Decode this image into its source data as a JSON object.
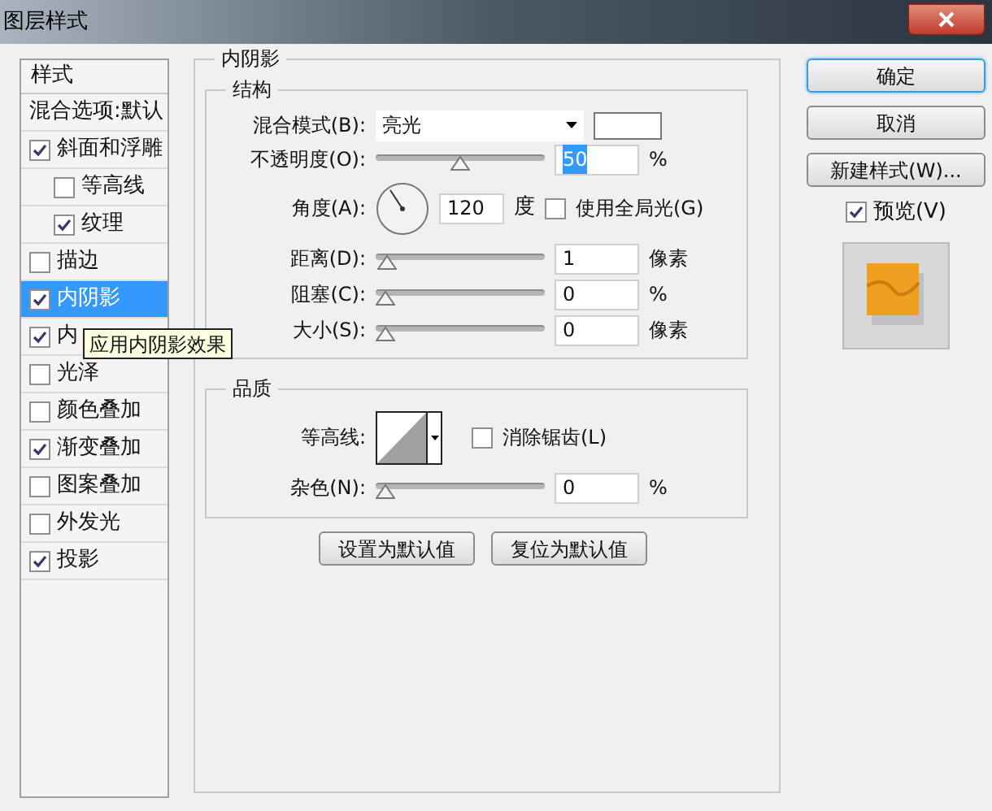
{
  "window": {
    "title": "图层样式"
  },
  "sidebar": {
    "header": "样式",
    "items": [
      {
        "kind": "plain",
        "label": "混合选项:默认",
        "selected": false
      },
      {
        "kind": "check",
        "label": "斜面和浮雕",
        "checked": true,
        "selected": false,
        "children": [
          {
            "kind": "check",
            "label": "等高线",
            "checked": false,
            "selected": false
          },
          {
            "kind": "check",
            "label": "纹理",
            "checked": true,
            "selected": false
          }
        ]
      },
      {
        "kind": "check",
        "label": "描边",
        "checked": false,
        "selected": false
      },
      {
        "kind": "check",
        "label": "内阴影",
        "checked": true,
        "selected": true
      },
      {
        "kind": "check",
        "label": "内",
        "checked": true,
        "selected": false
      },
      {
        "kind": "check",
        "label": "光泽",
        "checked": false,
        "selected": false
      },
      {
        "kind": "check",
        "label": "颜色叠加",
        "checked": false,
        "selected": false
      },
      {
        "kind": "check",
        "label": "渐变叠加",
        "checked": true,
        "selected": false
      },
      {
        "kind": "check",
        "label": "图案叠加",
        "checked": false,
        "selected": false
      },
      {
        "kind": "check",
        "label": "外发光",
        "checked": false,
        "selected": false
      },
      {
        "kind": "check",
        "label": "投影",
        "checked": true,
        "selected": false
      }
    ]
  },
  "tooltip": "应用内阴影效果",
  "panel": {
    "title": "内阴影",
    "structure": {
      "title": "结构",
      "blend_mode": {
        "label": "混合模式(B):",
        "value": "亮光"
      },
      "opacity": {
        "label": "不透明度(O):",
        "level": 0.5,
        "value": "50",
        "value_selected": true,
        "unit": "%"
      },
      "angle": {
        "label": "角度(A):",
        "value": "120",
        "unit": "度",
        "global_light": {
          "label": "使用全局光(G)",
          "checked": false
        }
      },
      "sliders": [
        {
          "label": "距离(D):",
          "level": 0.01,
          "value": "1",
          "unit": "像素"
        },
        {
          "label": "阻塞(C):",
          "level": 0,
          "value": "0",
          "unit": "%"
        },
        {
          "label": "大小(S):",
          "level": 0,
          "value": "0",
          "unit": "像素"
        }
      ]
    },
    "quality": {
      "title": "品质",
      "contour": {
        "label": "等高线:"
      },
      "anti_alias": {
        "label": "消除锯齿(L)",
        "checked": false
      },
      "noise": {
        "label": "杂色(N):",
        "level": 0,
        "value": "0",
        "unit": "%"
      }
    },
    "buttons": [
      "设置为默认值",
      "复位为默认值"
    ]
  },
  "actions": {
    "buttons": [
      {
        "label": "确定",
        "default": true
      },
      {
        "label": "取消",
        "default": false
      },
      {
        "label": "新建样式(W)...",
        "default": false
      }
    ],
    "preview": {
      "label": "预览(V)",
      "checked": true
    }
  }
}
